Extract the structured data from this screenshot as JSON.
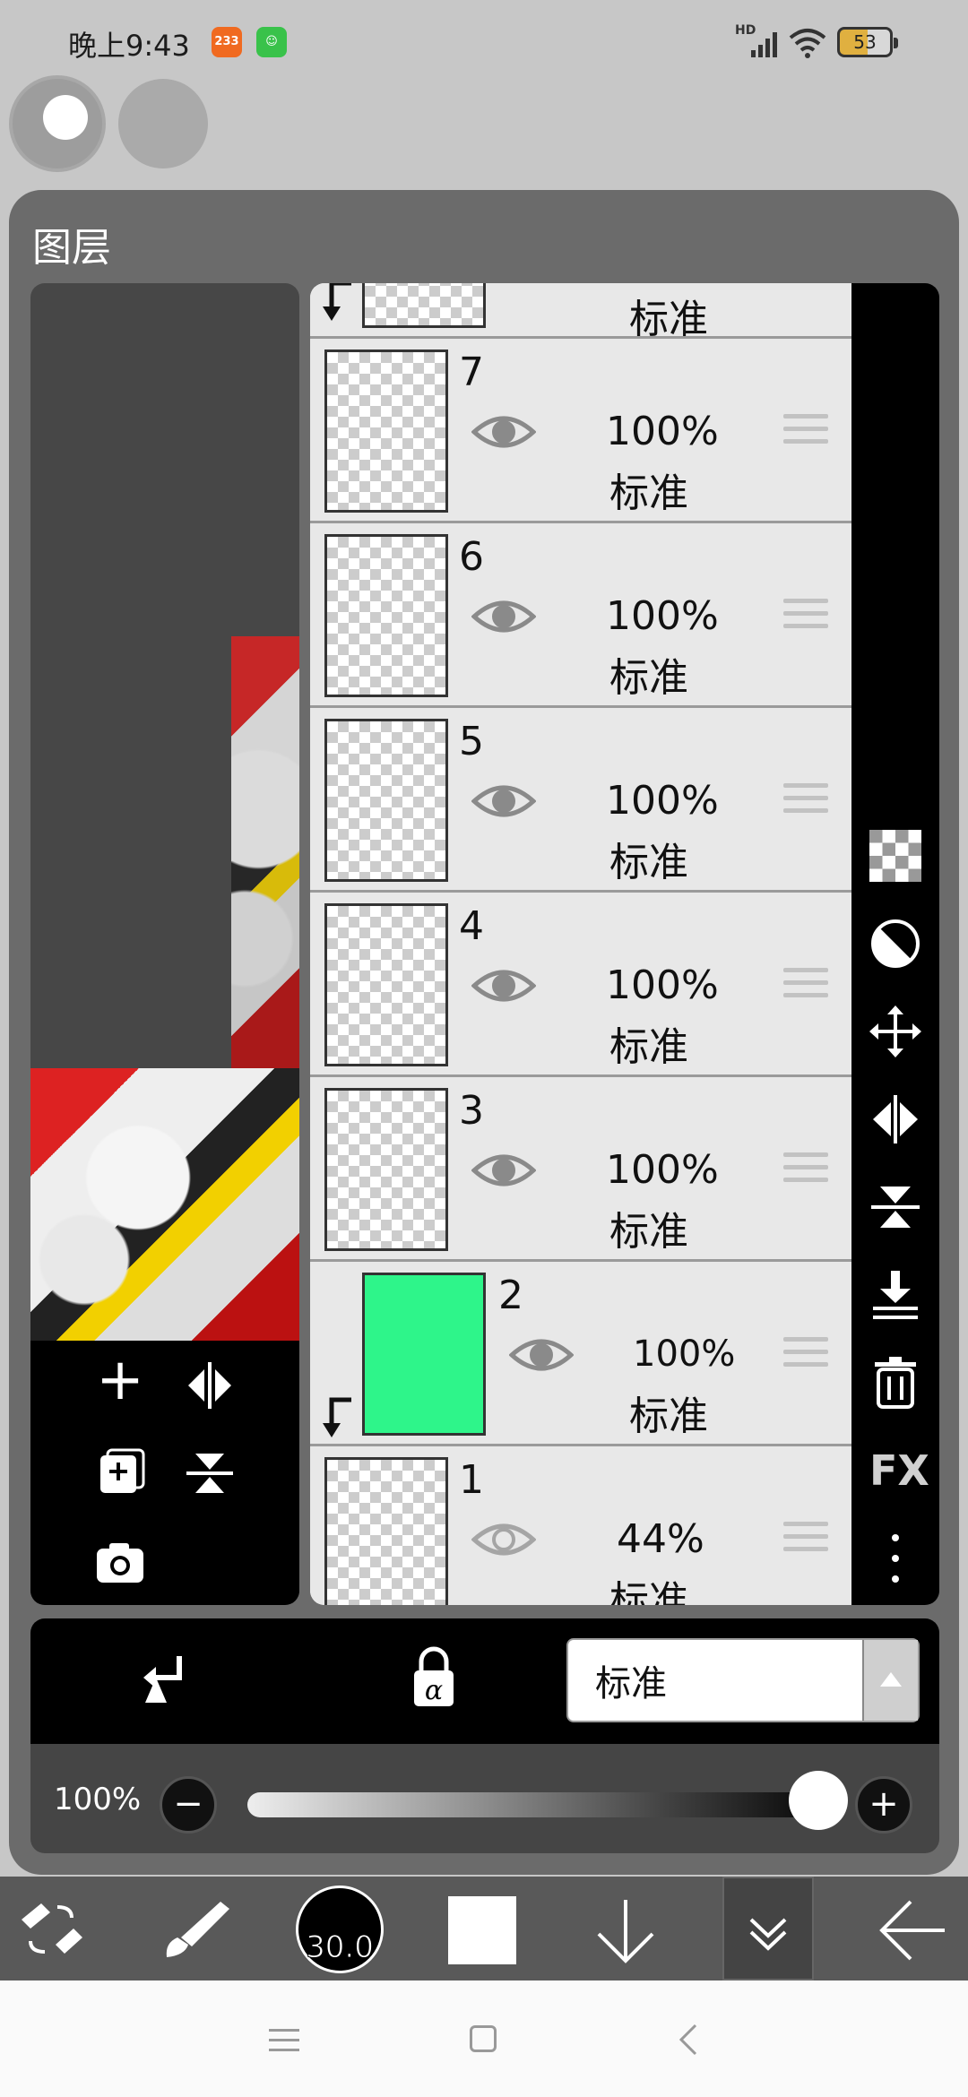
{
  "status_bar": {
    "time": "晚上9:43",
    "badge_1": "233",
    "hd_label": "HD",
    "battery": "53"
  },
  "panel": {
    "title": "图层"
  },
  "layers": [
    {
      "number": "",
      "opacity": "",
      "mode": "标准",
      "clipped": true,
      "partial": "top"
    },
    {
      "number": "7",
      "opacity": "100%",
      "mode": "标准",
      "visible": true
    },
    {
      "number": "6",
      "opacity": "100%",
      "mode": "标准",
      "visible": true
    },
    {
      "number": "5",
      "opacity": "100%",
      "mode": "标准",
      "visible": true
    },
    {
      "number": "4",
      "opacity": "100%",
      "mode": "标准",
      "visible": true
    },
    {
      "number": "3",
      "opacity": "100%",
      "mode": "标准",
      "visible": true
    },
    {
      "number": "2",
      "opacity": "100%",
      "mode": "标准",
      "visible": true,
      "clipped": true,
      "thumb_color": "#2ef58a"
    },
    {
      "number": "1",
      "opacity": "44%",
      "mode": "标准",
      "visible": false,
      "partial": "bottom"
    }
  ],
  "right_tools": [
    "checkerboard-icon",
    "half-circle-icon",
    "move-icon",
    "flip-horizontal-icon",
    "flip-vertical-icon",
    "merge-down-icon",
    "delete-icon",
    "FX",
    "more-icon"
  ],
  "right_tools_fx_label": "FX",
  "left_tools": [
    "add-layer-icon",
    "flip-layer-icon",
    "duplicate-layer-icon",
    "flip-vertical-icon",
    "camera-icon"
  ],
  "blend_mode": {
    "value": "标准"
  },
  "opacity": {
    "label": "100%",
    "value": 1.0
  },
  "toolbar": {
    "brush_size": "30.0"
  },
  "colors": {
    "panel": "#6b6b6b",
    "layer2_fill": "#2ef58a"
  }
}
